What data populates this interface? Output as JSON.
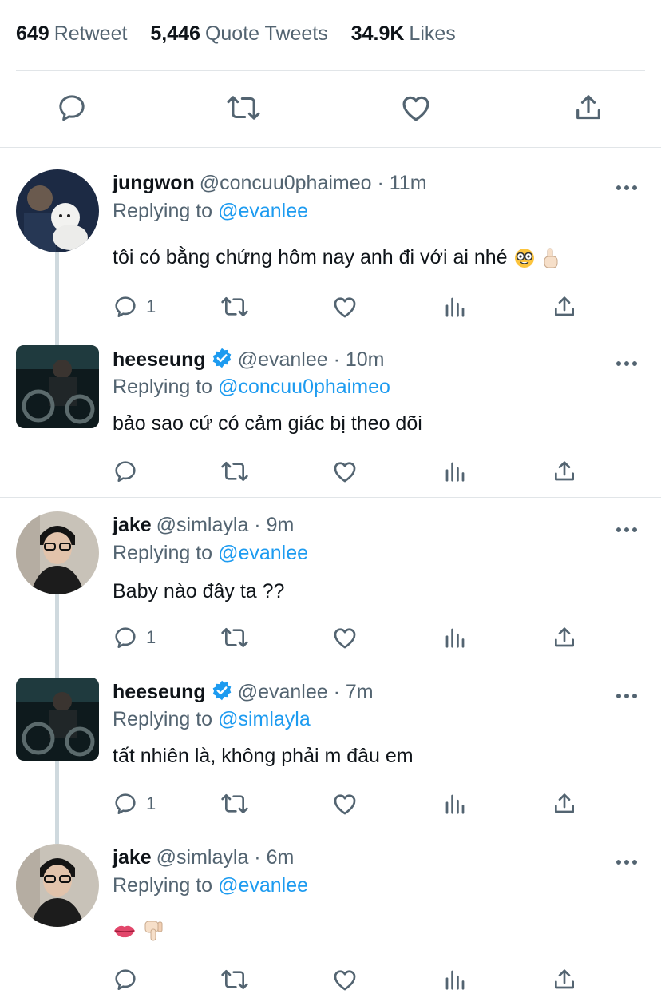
{
  "stats": {
    "retweets": {
      "count": "649",
      "label": "Retweet"
    },
    "quotes": {
      "count": "5,446",
      "label": "Quote Tweets"
    },
    "likes": {
      "count": "34.9K",
      "label": "Likes"
    }
  },
  "main_actions": [
    "reply-icon",
    "retweet-icon",
    "like-icon",
    "share-icon"
  ],
  "colors": {
    "mention": "#1d9bf0",
    "verified": "#1d9bf0",
    "secondary": "#536471",
    "divider": "#e1e5e8",
    "thread": "#cfd9de"
  },
  "tweets": [
    {
      "name": "jungwon",
      "handle": "@concuu0phaimeo · 11m",
      "replying_label": "Replying to",
      "replying_to": "@evanlee",
      "text": "tôi có bằng chứng hôm nay anh đi với ai nhé",
      "emojis": [
        "nerd-face-emoji",
        "index-pointing-up-emoji"
      ],
      "reply_count": "1",
      "verified": false
    },
    {
      "name": "heeseung",
      "handle": "@evanlee · 10m",
      "replying_label": "Replying to",
      "replying_to": "@concuu0phaimeo",
      "text": "bảo sao cứ có cảm giác bị theo dõi",
      "emojis": [],
      "reply_count": "",
      "verified": true
    },
    {
      "name": "jake",
      "handle": "@simlayla · 9m",
      "replying_label": "Replying to",
      "replying_to": "@evanlee",
      "text": "Baby nào đây ta ??",
      "emojis": [],
      "reply_count": "1",
      "verified": false
    },
    {
      "name": "heeseung",
      "handle": "@evanlee · 7m",
      "replying_label": "Replying to",
      "replying_to": "@simlayla",
      "text": "tất nhiên là, không phải m đâu em",
      "emojis": [],
      "reply_count": "1",
      "verified": true
    },
    {
      "name": "jake",
      "handle": "@simlayla · 6m",
      "replying_label": "Replying to",
      "replying_to": "@evanlee",
      "text": "",
      "emojis": [
        "lips-emoji",
        "thumbs-down-emoji"
      ],
      "reply_count": "",
      "verified": false
    }
  ]
}
